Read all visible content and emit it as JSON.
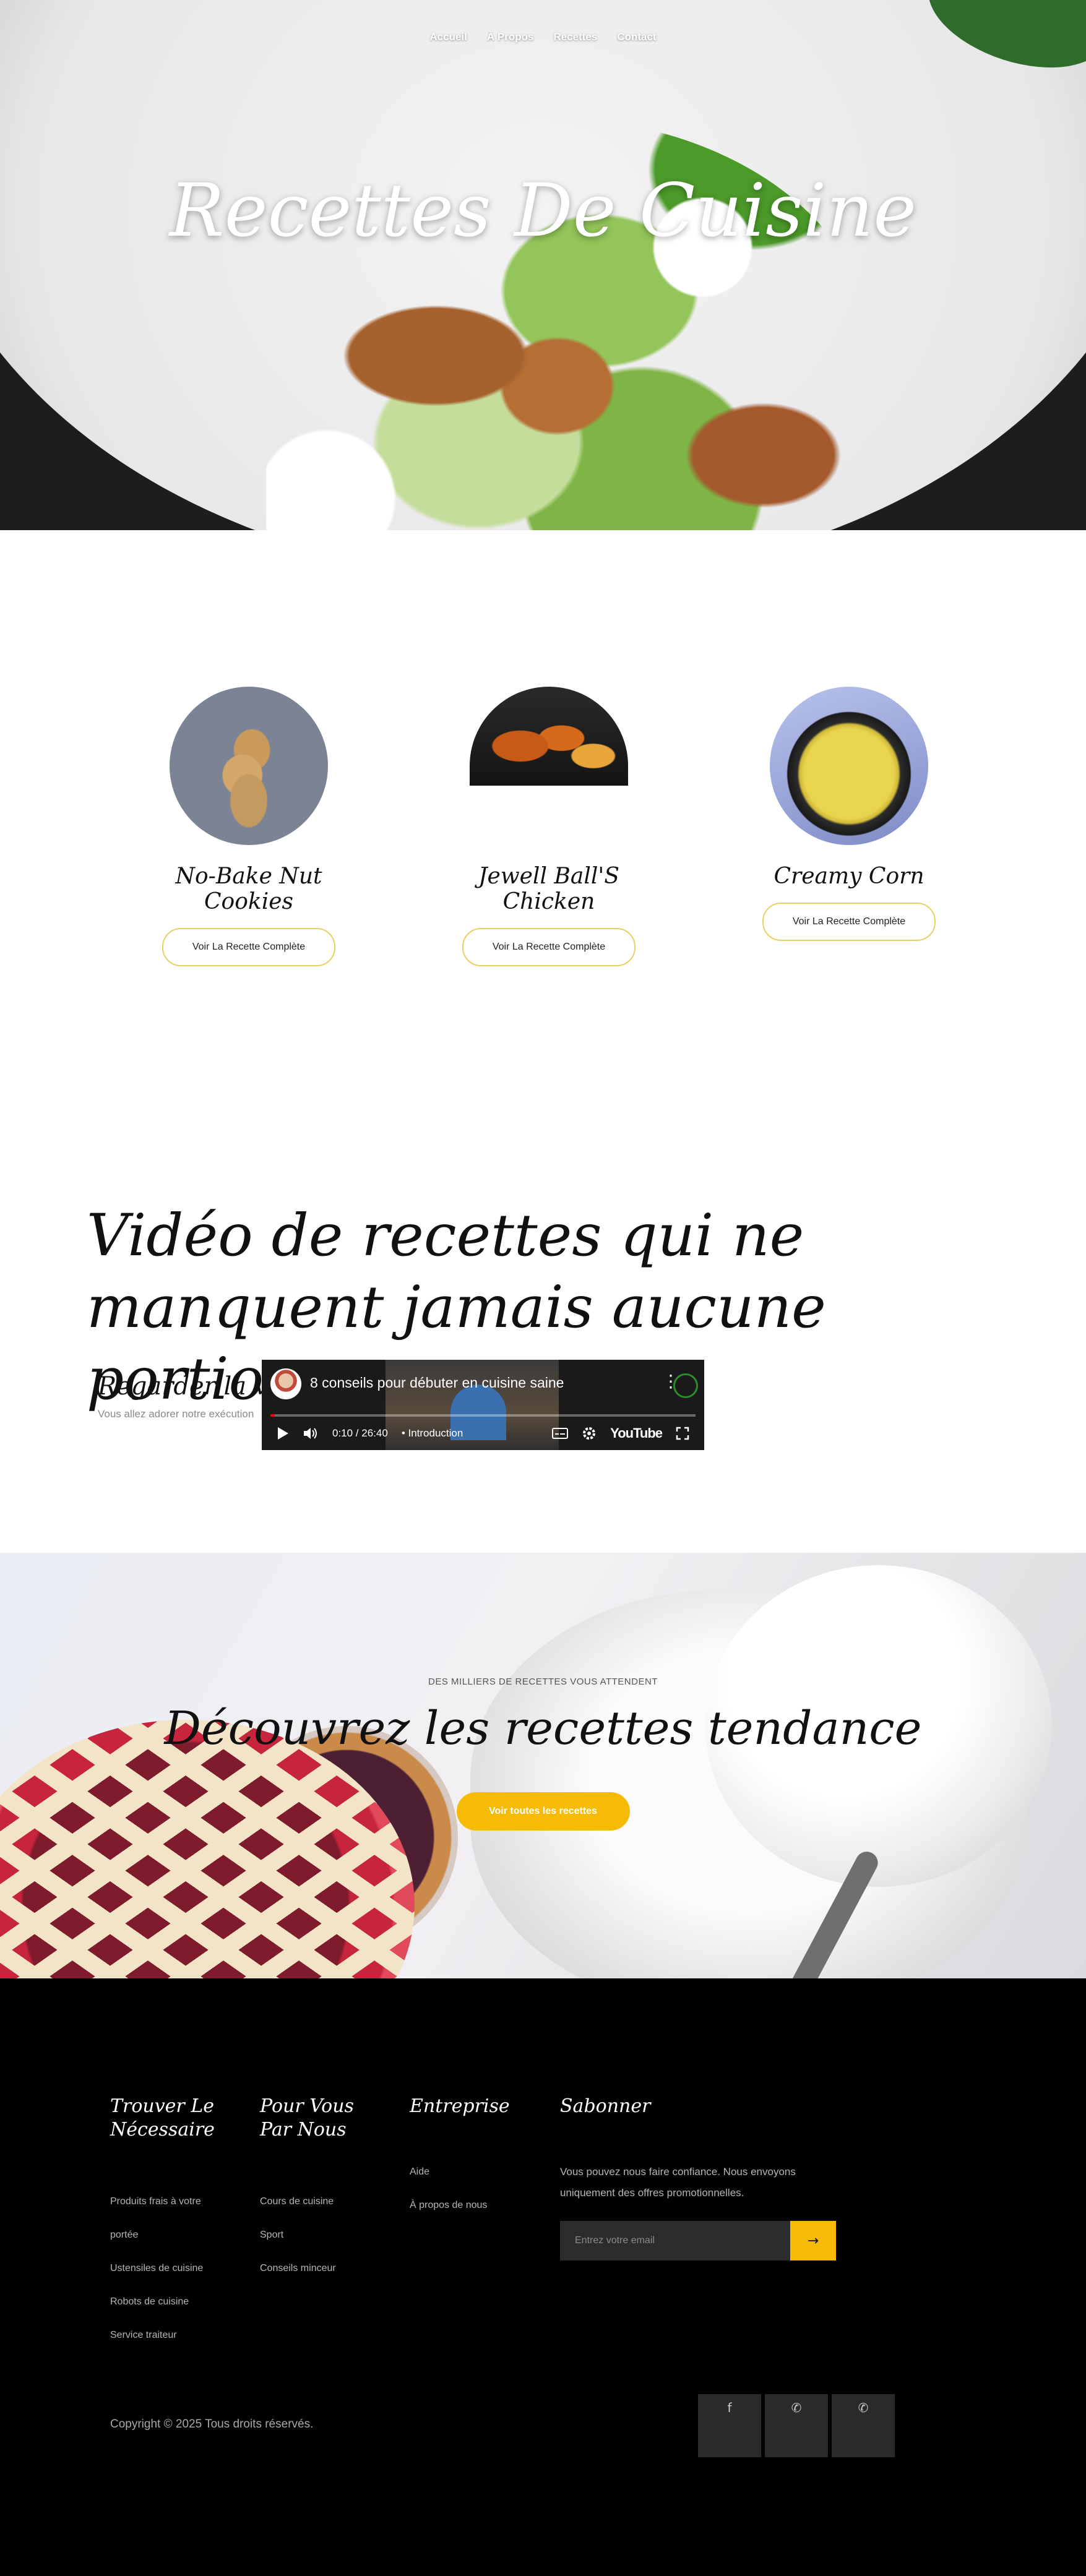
{
  "nav": {
    "items": [
      "Accueil",
      "À Propos",
      "Recettes",
      "Contact"
    ]
  },
  "hero": {
    "title": "Recettes De Cuisine"
  },
  "recipes": [
    {
      "name": "No-Bake Nut Cookies",
      "button": "Voir La Recette Complète"
    },
    {
      "name": "Jewell Ball'S Chicken",
      "button": "Voir La Recette Complète"
    },
    {
      "name": "Creamy Corn",
      "button": "Voir La Recette Complète"
    }
  ],
  "video_section": {
    "heading": "Vidéo de recettes qui ne manquent jamais aucune portion",
    "watch_title": "Regarder la vidéo",
    "watch_text": "Vous allez adorer notre exécution",
    "player": {
      "title": "8 conseils pour débuter en cuisine saine",
      "time": "0:10 / 26:40",
      "chapter": "• Introduction",
      "progress_percent": 1,
      "brand": "YouTube"
    }
  },
  "trending": {
    "eyebrow": "DES MILLIERS DE RECETTES VOUS ATTENDENT",
    "title": "Découvrez les recettes tendance",
    "button": "Voir toutes les recettes"
  },
  "footer": {
    "col1": {
      "title": "Trouver Le Nécessaire",
      "items": [
        "Produits frais à votre",
        "portée",
        "Ustensiles de cuisine",
        "Robots de cuisine",
        "Service traiteur"
      ]
    },
    "col2": {
      "title": "Pour Vous Par Nous",
      "items": [
        "Cours de cuisine",
        "Sport",
        "Conseils minceur"
      ]
    },
    "col3": {
      "title": "Entreprise",
      "items": [
        "Aide",
        "À propos de nous"
      ]
    },
    "col4": {
      "title": "Sabonner",
      "text": "Vous pouvez nous faire confiance. Nous envoyons uniquement des offres promotionnelles.",
      "placeholder": "Entrez votre email",
      "submit_icon": "arrow-right-icon"
    },
    "copyright": "Copyright © 2025 Tous droits réservés.",
    "social": [
      "facebook-icon",
      "whatsapp-icon",
      "whatsapp-icon"
    ]
  },
  "colors": {
    "accent": "#f6bb06",
    "outline": "#e9cf63",
    "footer_bg": "#000000"
  }
}
